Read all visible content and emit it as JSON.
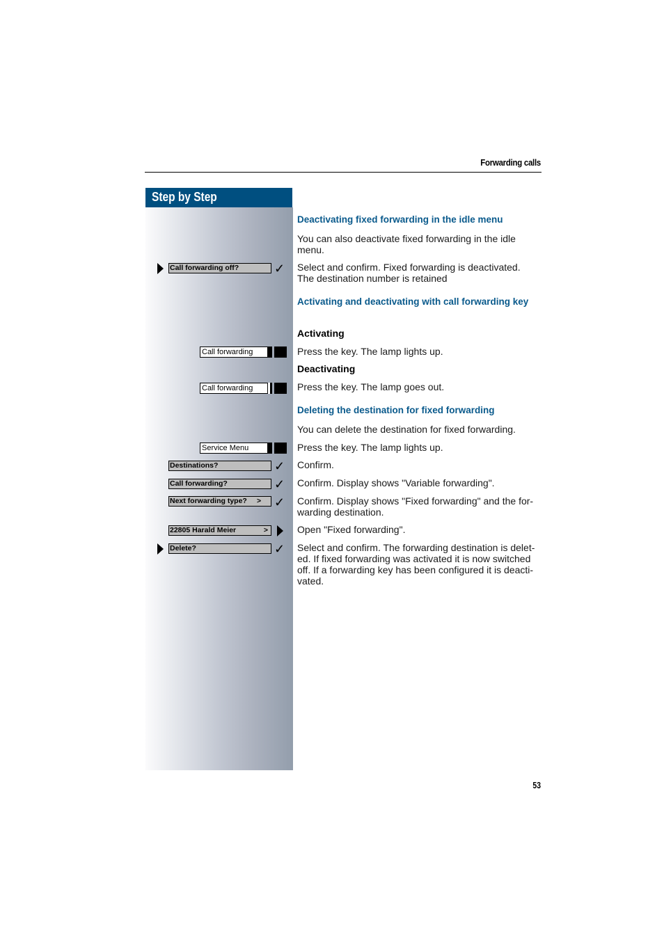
{
  "header": {
    "title": "Forwarding calls"
  },
  "sidebar": {
    "banner": "Step by Step",
    "steps": [
      {
        "type": "display",
        "text": "Call forwarding off?",
        "marker": "select-arrow",
        "action": "check"
      },
      {
        "type": "key",
        "text": "Call forwarding",
        "lamp": "on"
      },
      {
        "type": "key",
        "text": "Call forwarding",
        "lamp": "off"
      },
      {
        "type": "key",
        "text": "Service Menu",
        "lamp": "on"
      },
      {
        "type": "display",
        "text": "Destinations?",
        "action": "check"
      },
      {
        "type": "display",
        "text": "Call forwarding?",
        "action": "check"
      },
      {
        "type": "display",
        "text": "Next forwarding type?",
        "suffix": ">",
        "action": "check"
      },
      {
        "type": "display",
        "text": "22805 Harald Meier",
        "suffix": ">",
        "action": "open-arrow"
      },
      {
        "type": "display",
        "text": "Delete?",
        "marker": "select-arrow",
        "action": "check"
      }
    ]
  },
  "content": {
    "section1": {
      "heading": "Deactivating fixed forwarding in the idle menu",
      "intro": "You can also deactivate fixed forwarding in the idle menu.",
      "step1": "Select and confirm. Fixed forwarding is deactivated. The destination number is retained"
    },
    "section2": {
      "heading": "Activating and deactivating with call forwarding key",
      "sub1": "Activating",
      "sub1_text": "Press the key. The lamp lights up.",
      "sub2": "Deactivating",
      "sub2_text": "Press the key. The lamp goes out."
    },
    "section3": {
      "heading": "Deleting the destination for fixed forwarding",
      "intro": "You can delete the destination for fixed forwarding.",
      "steps": [
        "Press the key. The lamp lights up.",
        "Confirm.",
        "Confirm. Display shows \"Variable forwarding\".",
        "Confirm. Display shows \"Fixed forwarding\" and the for-warding destination.",
        "Open \"Fixed forwarding\".",
        "Select and confirm. The forwarding destination is delet-ed. If fixed forwarding was activated it is now switched off. If a forwarding key has been configured it is deacti-vated."
      ]
    }
  },
  "footer": {
    "page_number": "53"
  }
}
